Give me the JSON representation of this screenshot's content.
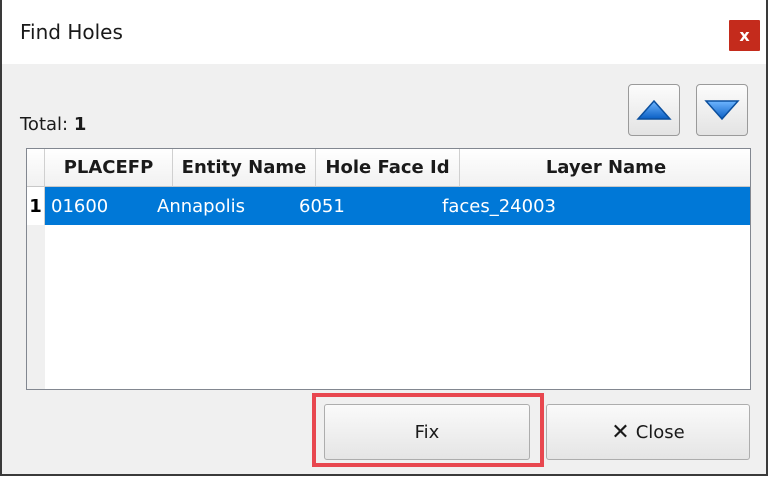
{
  "window": {
    "title": "Find Holes",
    "close_glyph": "x"
  },
  "summary": {
    "total_label": "Total:",
    "total_value": "1"
  },
  "nav": {
    "up_icon": "triangle-up-icon",
    "down_icon": "triangle-down-icon"
  },
  "table": {
    "columns": [
      "PLACEFP",
      "Entity Name",
      "Hole Face Id",
      "Layer Name"
    ],
    "rows": [
      {
        "num": "1",
        "cells": [
          "01600",
          "Annapolis",
          "6051",
          "faces_24003"
        ],
        "selected": true
      }
    ]
  },
  "buttons": {
    "fix_label": "Fix",
    "close_label": "Close",
    "close_icon": "x-mark-icon"
  },
  "colors": {
    "selection": "#0078d7",
    "highlight": "#e8474f",
    "close_button": "#c42b1c",
    "arrow_blue": "#1e7fe0"
  }
}
